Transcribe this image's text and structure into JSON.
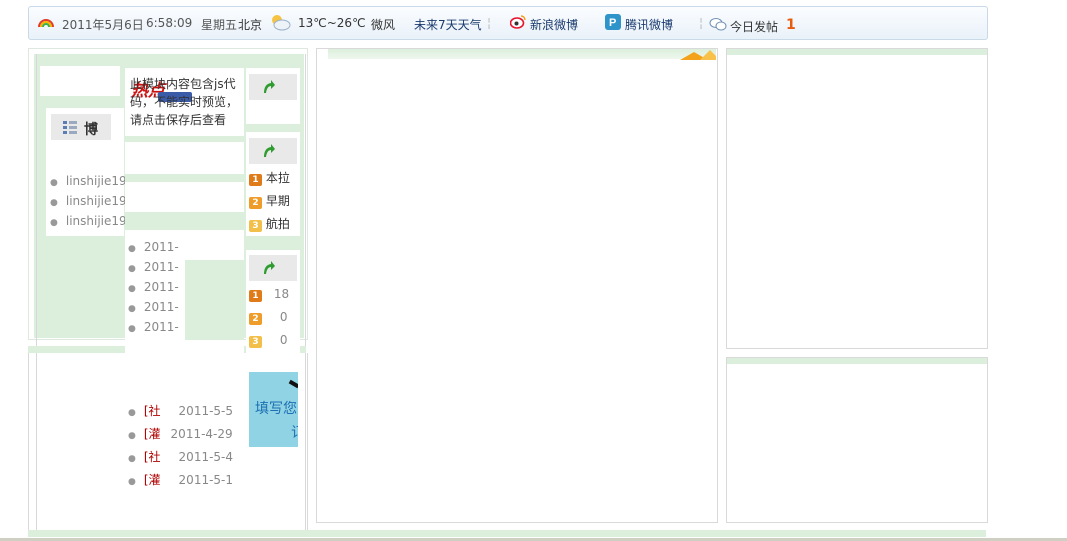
{
  "topbar": {
    "date": "2011年5月6日",
    "time": "6:58:09",
    "weekday": "星期五",
    "city": "北京",
    "temperature": "13℃~26℃",
    "wind": "微风",
    "forecast_link": "未来7天天气",
    "sina_weibo": "新浪微博",
    "tencent_weibo": "腾讯微博",
    "today_posts_label": "今日发帖",
    "today_posts_count": "1"
  },
  "notice": {
    "line1": "此模块内容包含js代",
    "line2": "码，不能实时预览，",
    "line3": "请点击保存后查看"
  },
  "hot_badge": "热点",
  "blog_tab": "博",
  "blog_users": [
    "linshijie19",
    "linshijie19",
    "linshijie19"
  ],
  "dates_list": [
    "2011-",
    "2011-",
    "2011-",
    "2011-",
    "2011-"
  ],
  "ranking_titles": [
    "本拉",
    "早期",
    "航拍"
  ],
  "ranking_counts": [
    "18",
    "0",
    "0"
  ],
  "ad_banner": {
    "line1": "填写您",
    "line2": "订"
  },
  "news": [
    {
      "tag": "[社",
      "date": "2011-5-5"
    },
    {
      "tag": "[灌",
      "date": "2011-4-29"
    },
    {
      "tag": "[社",
      "date": "2011-5-4"
    },
    {
      "tag": "[灌",
      "date": "2011-5-1"
    }
  ],
  "colors": {
    "accent_green": "#dcefdc",
    "number_orange": "#e85c0d",
    "link_blue": "#1a3a6e"
  }
}
